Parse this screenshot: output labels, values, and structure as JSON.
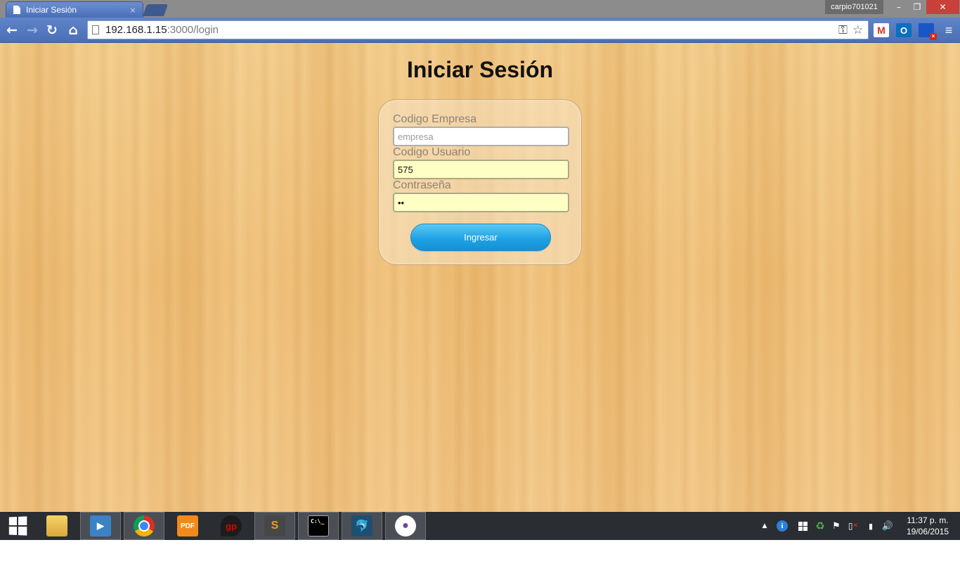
{
  "browser": {
    "tab_title": "Iniciar Sesión",
    "tab_close": "×",
    "profile_name": "carpio701021",
    "window_buttons": {
      "minimize": "–",
      "maximize": "❐",
      "close": "✕"
    },
    "nav": {
      "back": "←",
      "forward": "→",
      "reload": "↻",
      "home": "⌂"
    },
    "url_host": "192.168.1.15",
    "url_rest": ":3000/login",
    "omnibox_icons": {
      "key": "⚿",
      "star": "☆"
    },
    "extensions": {
      "gmail": "M",
      "outlook": "O",
      "monitor": "",
      "monitor_badge": "×",
      "menu": "≡"
    }
  },
  "page": {
    "title": "Iniciar Sesión",
    "form": {
      "empresa_label": "Codigo Empresa",
      "empresa_placeholder": "empresa",
      "empresa_value": "",
      "usuario_label": "Codigo Usuario",
      "usuario_value": "575",
      "password_label": "Contraseña",
      "password_value": "ab",
      "submit_label": "Ingresar"
    }
  },
  "taskbar": {
    "apps": [
      {
        "name": "file-explorer",
        "label": ""
      },
      {
        "name": "media-player",
        "label": "▶"
      },
      {
        "name": "chrome",
        "label": ""
      },
      {
        "name": "pdf-app",
        "label": "PDF"
      },
      {
        "name": "guitar-pro",
        "label": "gp"
      },
      {
        "name": "sublime-text",
        "label": "S"
      },
      {
        "name": "command-prompt",
        "label": "C:\\_"
      },
      {
        "name": "mysql-workbench",
        "label": "🐬"
      },
      {
        "name": "github",
        "label": "●"
      }
    ],
    "tray": {
      "chevron": "▲",
      "info": "i",
      "network": "▮",
      "volume": "🔊"
    },
    "time": "11:37 p. m.",
    "date": "19/06/2015"
  },
  "colors": {
    "wood": "#f0c27f",
    "button_blue": "#1fa2e4",
    "autofill_yellow": "#fdffc4",
    "chrome_blue": "#4a6fb5",
    "taskbar": "#2a2d31"
  }
}
